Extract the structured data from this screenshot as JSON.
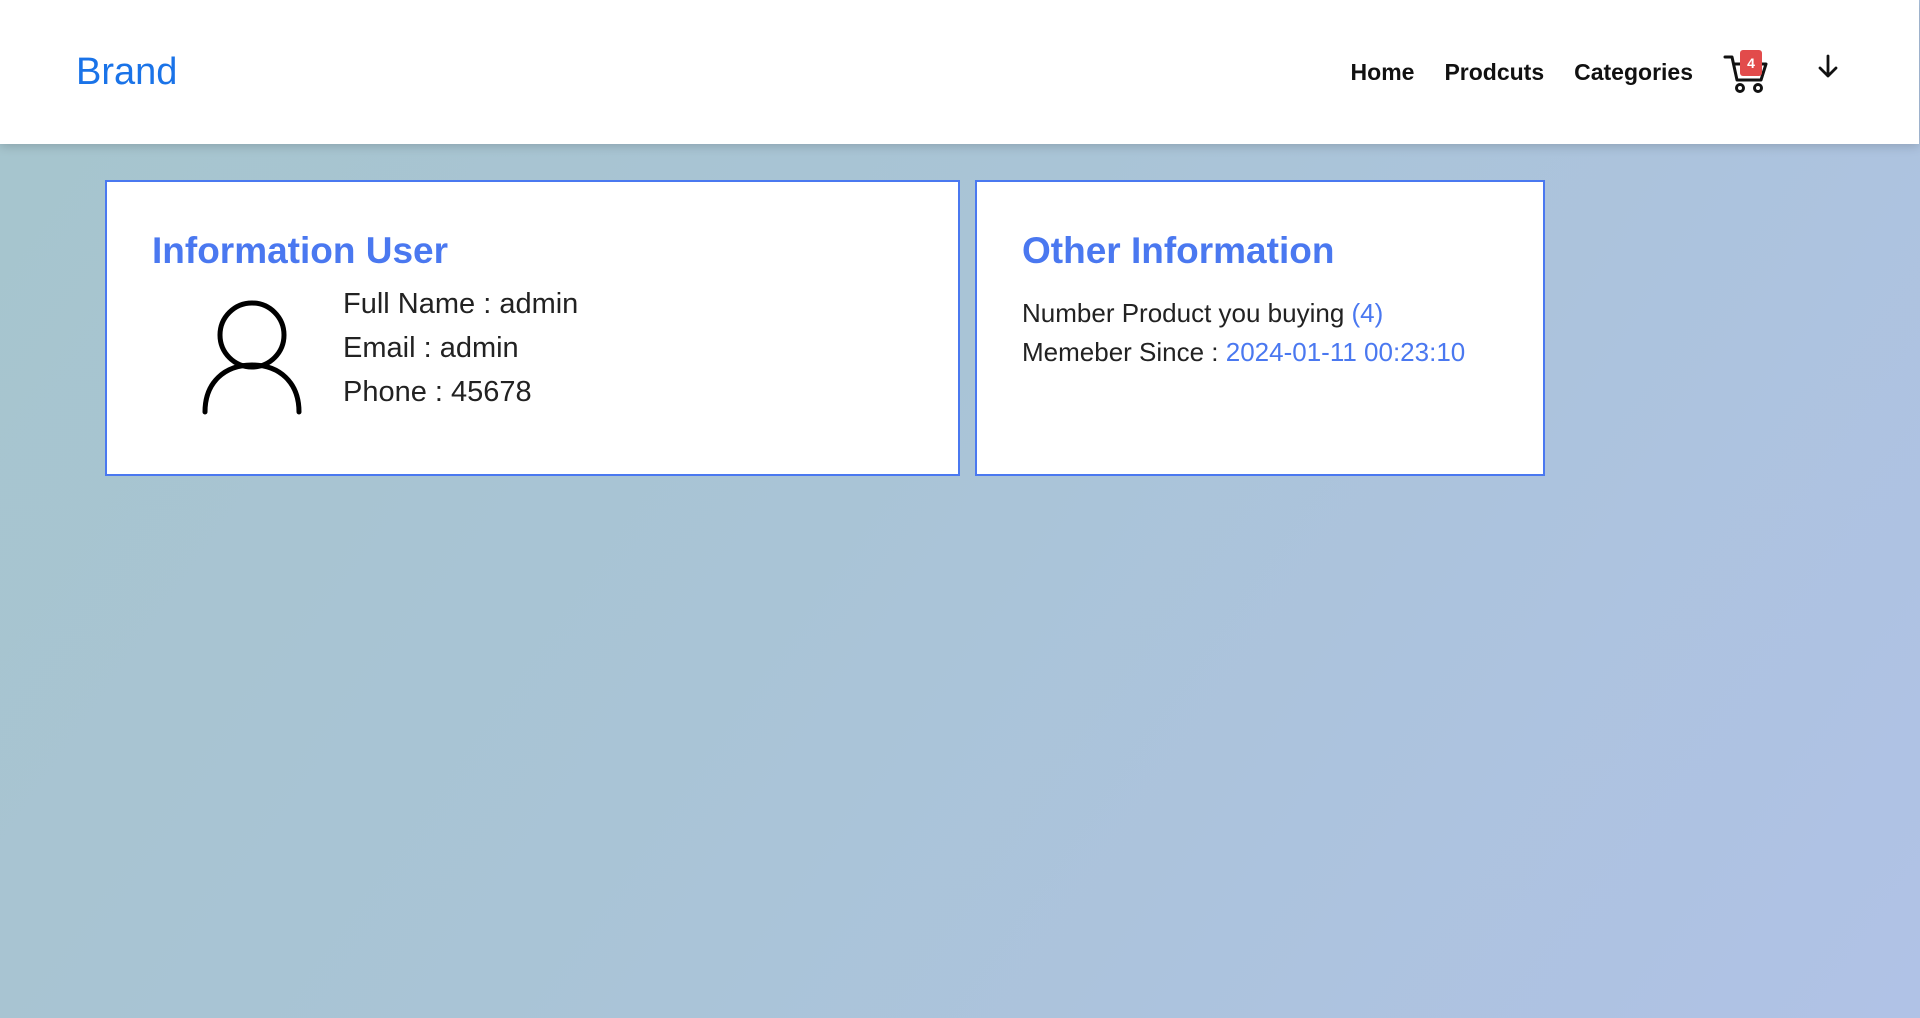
{
  "navbar": {
    "brand": "Brand",
    "links": [
      "Home",
      "Prodcuts",
      "Categories"
    ],
    "cart_count": "4"
  },
  "user_card": {
    "title": "Information User",
    "full_name_label": "Full Name : ",
    "full_name": "admin",
    "email_label": "Email : ",
    "email": "admin",
    "phone_label": "Phone : ",
    "phone": "45678"
  },
  "other_card": {
    "title": "Other Information",
    "products_label": "Number Product you buying ",
    "products_count": "(4)",
    "member_label": "Memeber Since : ",
    "member_since": "2024-01-11 00:23:10"
  },
  "icons": {
    "cart": "cart-icon",
    "avatar": "user-icon",
    "dropdown": "arrow-down-icon"
  },
  "colors": {
    "accent": "#4a78f0",
    "brand": "#1a73e8",
    "badge": "#e24b4b"
  }
}
